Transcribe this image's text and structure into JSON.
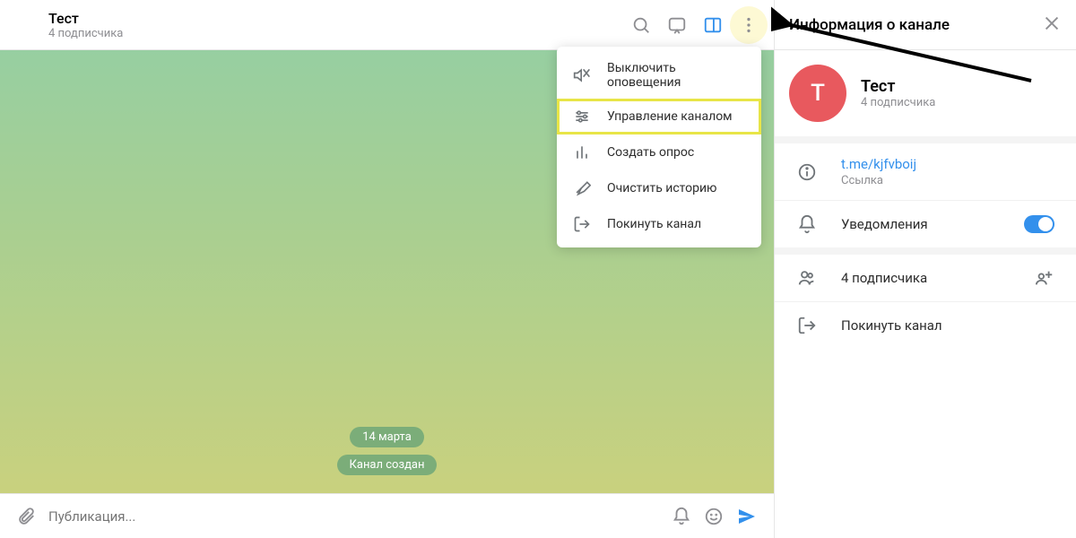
{
  "header": {
    "title": "Тест",
    "subtitle": "4 подписчика"
  },
  "chat": {
    "date": "14 марта",
    "system_msg": "Канал создан"
  },
  "compose": {
    "placeholder": "Публикация..."
  },
  "dropdown": {
    "items": {
      "mute": "Выключить оповещения",
      "manage": "Управление каналом",
      "poll": "Создать опрос",
      "clear": "Очистить историю",
      "leave": "Покинуть канал"
    }
  },
  "side": {
    "title": "Информация о канале",
    "avatar_letter": "T",
    "name": "Тест",
    "subscribers": "4 подписчика",
    "link": "t.me/kjfvboij",
    "link_label": "Ссылка",
    "notifications": "Уведомления",
    "members": "4 подписчика",
    "leave": "Покинуть канал"
  }
}
